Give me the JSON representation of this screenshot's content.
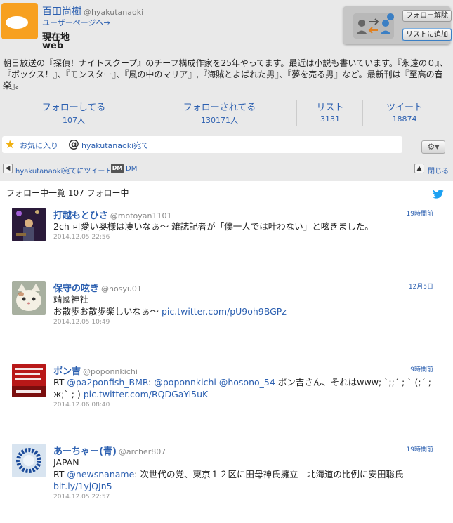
{
  "profile": {
    "name": "百田尚樹",
    "handle": "@hyakutanaoki",
    "user_page_link": "ユーザーページへ→",
    "location_label": "現在地",
    "location_value": "web",
    "bio": "朝日放送の『探偵！ナイトスクープ』のチーフ構成作家を25年やってます。最近は小説も書いています。『永遠の０』、『ボックス！』、『モンスター』、『風の中のマリア』,『海賊とよばれた男』、『夢を売る男』など。最新刊は『至高の音楽』。",
    "unfollow_button": "フォロー解除",
    "add_to_list_button": "リストに追加"
  },
  "stats": [
    {
      "label": "フォローしてる",
      "value": "107人"
    },
    {
      "label": "フォローされてる",
      "value": "130171人"
    },
    {
      "label": "リスト",
      "value": "3131"
    },
    {
      "label": "ツイート",
      "value": "18874"
    }
  ],
  "tabs": {
    "favorites": "お気に入り",
    "mentions": "hyakutanaoki宛て"
  },
  "toolbar": {
    "tweet_to": "hyakutanaoki宛てにツイート",
    "dm_badge": "DM",
    "dm": "DM",
    "close": "閉じる"
  },
  "panel": {
    "title": "フォロー中一覧 107 フォロー中"
  },
  "tweets": [
    {
      "name": "打越もとひさ",
      "handle": "@motoyan1101",
      "ago": "19時間前",
      "text": "2ch 可愛い奥様は凄いなぁ〜 雑誌記者が「僕一人では叶わない」と呟きました。",
      "timestamp": "2014.12.05 22:56"
    },
    {
      "name": "保守の呟き",
      "handle": "@hosyu01",
      "ago": "12月5日",
      "line1": "靖國神社",
      "line2_prefix": "お散歩お散歩楽しいなぁ〜 ",
      "link": "pic.twitter.com/pU9oh9BGPz",
      "timestamp": "2014.12.05 10:49"
    },
    {
      "name": "ポン吉",
      "handle": "@poponnkichi",
      "ago": "9時間前",
      "rt": "RT ",
      "m1": "@pa2ponfish_BMR",
      "sep1": ": ",
      "m2": "@poponnkichi",
      "sep2": " ",
      "m3": "@hosono_54",
      "rest": " ポン吉さん、それはwww; ˋ;;ˊ ; ˋ (;ˊ ; ж;ˋ ; ) ",
      "link": "pic.twitter.com/RQDGaYi5uK",
      "timestamp": "2014.12.06 08:40"
    },
    {
      "name": "あーちゃー(青)",
      "handle": "@archer807",
      "ago": "19時間前",
      "line1": "JAPAN",
      "rt": "RT ",
      "m1": "@newsnaname",
      "rest": ": 次世代の党、東京１２区に田母神氏擁立　北海道の比例に安田聡氏",
      "link": "bit.ly/1yjQJn5",
      "timestamp": "2014.12.05 22:57"
    }
  ],
  "colors": {
    "link_blue": "#2b5fb0",
    "avatar_orange": "#f7a020",
    "star_yellow": "#f0b010",
    "twitter_blue": "#1da1f2"
  }
}
